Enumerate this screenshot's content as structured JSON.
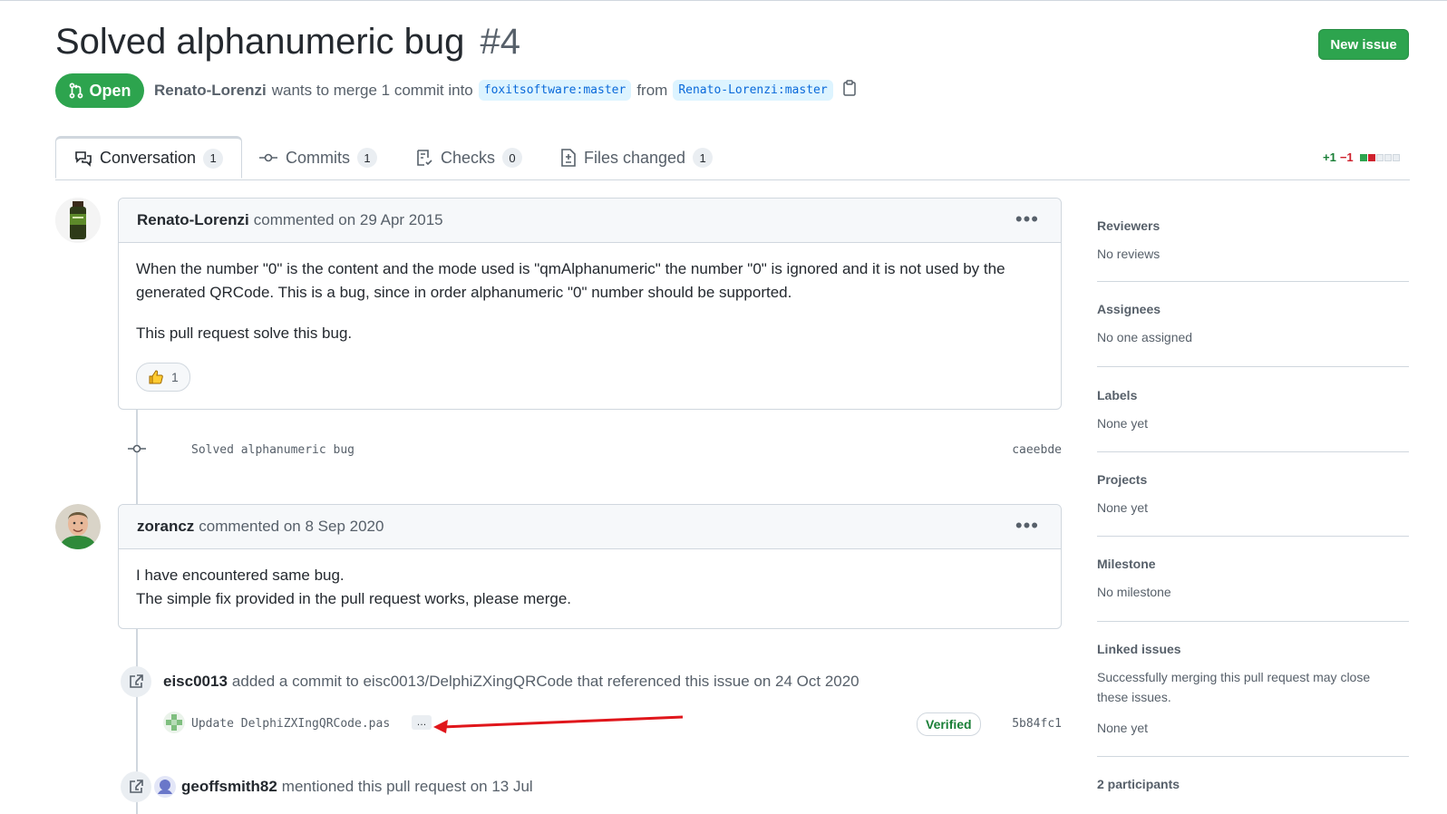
{
  "header": {
    "title": "Solved alphanumeric bug",
    "number": "#4",
    "new_issue_label": "New issue",
    "state_label": "Open",
    "author": "Renato-Lorenzi",
    "merge_text": "wants to merge 1 commit into",
    "base_branch": "foxitsoftware:master",
    "from_text": "from",
    "head_branch": "Renato-Lorenzi:master"
  },
  "tabs": [
    {
      "label": "Conversation",
      "count": "1"
    },
    {
      "label": "Commits",
      "count": "1"
    },
    {
      "label": "Checks",
      "count": "0"
    },
    {
      "label": "Files changed",
      "count": "1"
    }
  ],
  "diffstat": {
    "additions": "+1",
    "deletions": "−1"
  },
  "timeline": {
    "comment1": {
      "author": "Renato-Lorenzi",
      "meta": "commented on 29 Apr 2015",
      "para1": "When the number \"0\" is the content and the mode used is \"qmAlphanumeric\" the number \"0\" is ignored and it is not used by the generated QRCode. This is a bug, since in order alphanumeric \"0\" number should be supported.",
      "para2": "This pull request solve this bug.",
      "reaction_count": "1"
    },
    "commit": {
      "message": "Solved alphanumeric bug",
      "sha": "caeebde"
    },
    "comment2": {
      "author": "zorancz",
      "meta": "commented on 8 Sep 2020",
      "line1": "I have encountered same bug.",
      "line2": "The simple fix provided in the pull request works, please merge."
    },
    "event1": {
      "actor": "eisc0013",
      "text": "added a commit to eisc0013/DelphiZXingQRCode that referenced this issue on 24 Oct 2020",
      "commit_message": "Update DelphiZXIngQRCode.pas",
      "ellipsis": "…",
      "verified_label": "Verified",
      "sha": "5b84fc1"
    },
    "event2": {
      "actor": "geoffsmith82",
      "text": "mentioned this pull request on 13 Jul"
    }
  },
  "sidebar": {
    "reviewers": {
      "title": "Reviewers",
      "value": "No reviews"
    },
    "assignees": {
      "title": "Assignees",
      "value": "No one assigned"
    },
    "labels": {
      "title": "Labels",
      "value": "None yet"
    },
    "projects": {
      "title": "Projects",
      "value": "None yet"
    },
    "milestone": {
      "title": "Milestone",
      "value": "No milestone"
    },
    "linked_issues": {
      "title": "Linked issues",
      "description": "Successfully merging this pull request may close these issues.",
      "value": "None yet"
    },
    "participants": {
      "title": "2 participants"
    }
  },
  "colors": {
    "open_green": "#2da44e",
    "annotation_arrow": "#e0161b"
  }
}
